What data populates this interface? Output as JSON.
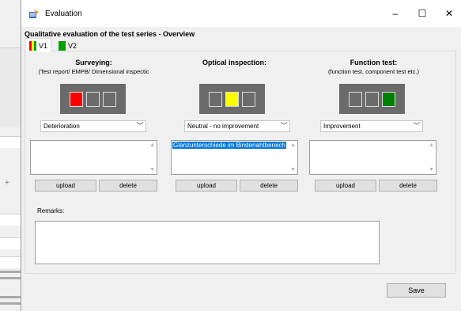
{
  "window": {
    "title": "Evaluation",
    "minimize_glyph": "–",
    "maximize_glyph": "☐",
    "close_glyph": "✕"
  },
  "heading": "Qualitative evaluation of the test series - Overview",
  "tabs": [
    {
      "label": "V1",
      "active": true,
      "flag_colors": [
        "#ff0000",
        "#ffff00",
        "#00a000"
      ]
    },
    {
      "label": "V2",
      "active": false,
      "flag_colors": [
        "#00a000",
        "#00a000",
        "#00a000"
      ]
    }
  ],
  "columns": [
    {
      "title": "Surveying:",
      "subtitle": "(Test report/ EMPB/ Dimensional inspectic",
      "lamps": [
        "#ff0000",
        "#6b6b6b",
        "#6b6b6b"
      ],
      "dropdown_value": "Deterioration",
      "list_items": [],
      "upload_label": "upload",
      "delete_label": "delete"
    },
    {
      "title": "Optical inspection:",
      "subtitle": "",
      "lamps": [
        "#6b6b6b",
        "#ffff00",
        "#6b6b6b"
      ],
      "dropdown_value": "Neutral - no improvement",
      "list_items": [
        "Glanzunterschiede im Bindenahtbereich"
      ],
      "upload_label": "upload",
      "delete_label": "delete"
    },
    {
      "title": "Function test:",
      "subtitle": "(function test, component test etc.)",
      "lamps": [
        "#6b6b6b",
        "#6b6b6b",
        "#008000"
      ],
      "dropdown_value": "Improvement",
      "list_items": [],
      "upload_label": "upload",
      "delete_label": "delete"
    }
  ],
  "remarks": {
    "label": "Remarks:",
    "value": ""
  },
  "save_label": "Save",
  "background": {
    "plus_glyph": "+"
  },
  "icons": {
    "app": "evaluation-app-icon",
    "scroll_up": "▲",
    "scroll_down": "▼",
    "chevron": "﹀"
  }
}
